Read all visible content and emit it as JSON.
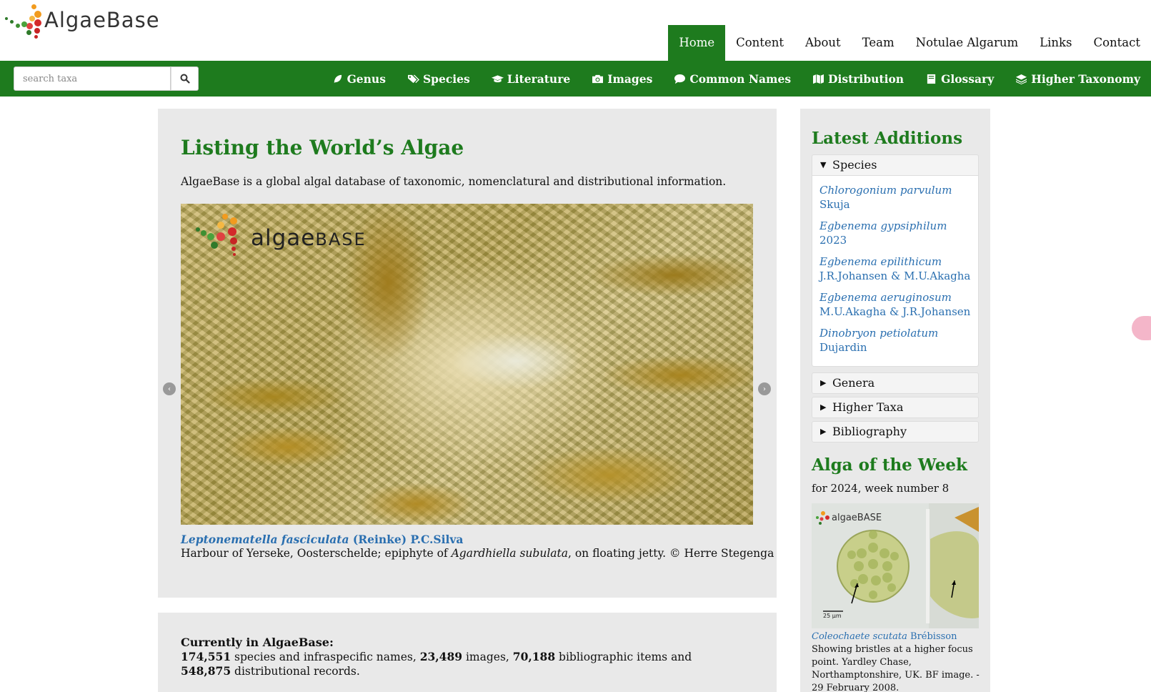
{
  "header": {
    "logo_text": "AlgaeBase",
    "nav": [
      {
        "label": "Home",
        "active": true
      },
      {
        "label": "Content"
      },
      {
        "label": "About"
      },
      {
        "label": "Team"
      },
      {
        "label": "Notulae Algarum"
      },
      {
        "label": "Links"
      },
      {
        "label": "Contact"
      }
    ]
  },
  "search": {
    "placeholder": "search taxa",
    "button_icon": "search-icon"
  },
  "subnav": [
    {
      "label": "Genus",
      "icon": "leaf-icon"
    },
    {
      "label": "Species",
      "icon": "tags-icon"
    },
    {
      "label": "Literature",
      "icon": "graduation-cap-icon"
    },
    {
      "label": "Images",
      "icon": "camera-icon"
    },
    {
      "label": "Common Names",
      "icon": "comment-icon"
    },
    {
      "label": "Distribution",
      "icon": "map-icon"
    },
    {
      "label": "Glossary",
      "icon": "book-icon"
    },
    {
      "label": "Higher Taxonomy",
      "icon": "layers-icon"
    }
  ],
  "main": {
    "title": "Listing the World’s Algae",
    "intro": "AlgaeBase is a global algal database of taxonomic, nomenclatural and distributional information.",
    "slide": {
      "logo_text_lower": "algae",
      "logo_text_upper": "BASE",
      "species": "Leptonematella fasciculata",
      "authority": "(Reinke) P.C.Silva",
      "caption_before": "Harbour of Yerseke, Oosterschelde; epiphyte of ",
      "caption_italic": "Agardhiella subulata",
      "caption_after": ", on floating jetty. © Herre Stegenga"
    },
    "arrows": {
      "prev": "‹",
      "next": "›"
    }
  },
  "stats": {
    "title": "Currently in AlgaeBase:",
    "species_count": "174,551",
    "species_label": " species and infraspecific names, ",
    "images_count": "23,489",
    "images_label": " images, ",
    "biblio_count": "70,188",
    "biblio_label": " bibliographic items and ",
    "distrib_count": "548,875",
    "distrib_label": " distributional records."
  },
  "sidebar": {
    "latest_title": "Latest Additions",
    "sections": [
      {
        "label": "Species",
        "expanded": true
      },
      {
        "label": "Genera",
        "expanded": false
      },
      {
        "label": "Higher Taxa",
        "expanded": false
      },
      {
        "label": "Bibliography",
        "expanded": false
      }
    ],
    "species_items": [
      {
        "name": "Chlorogonium parvulum",
        "author": "Skuja"
      },
      {
        "name": "Egbenema gypsiphilum",
        "author": "2023"
      },
      {
        "name": "Egbenema epilithicum",
        "author": "J.R.Johansen & M.U.Akagha"
      },
      {
        "name": "Egbenema aeruginosum",
        "author": "M.U.Akagha & J.R.Johansen"
      },
      {
        "name": "Dinobryon petiolatum",
        "author": "Dujardin"
      }
    ],
    "week_title": "Alga of the Week",
    "week_sub": "for 2024, week number 8",
    "week_img_logo": "algaeBASE",
    "week_img_scale": "25 µm",
    "week_species": "Coleochaete scutata",
    "week_authority": "Brébisson",
    "week_caption": "Showing bristles at a higher focus point. Yardley Chase, Northamptonshire, UK. BF image. - 29 February 2008."
  },
  "colors": {
    "brand_green": "#1e7b1e",
    "link_blue": "#2a6fb0",
    "panel_gray": "#e9e9e9"
  }
}
